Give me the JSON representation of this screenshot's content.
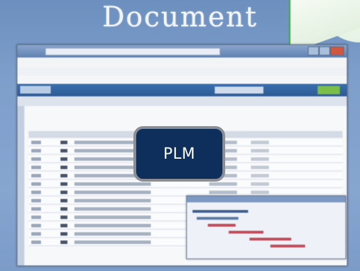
{
  "slide": {
    "title": "Document",
    "badge_label": "PLM"
  },
  "colors": {
    "slide_background": "#7f9fcb",
    "badge_fill": "#0e2f5c",
    "badge_border": "#8b8f95",
    "accent_line": "#3bbf3b"
  },
  "screenshot": {
    "kind": "blurred PLM web application screenshot",
    "table_row_count": 13,
    "has_gantt_popup": true
  }
}
